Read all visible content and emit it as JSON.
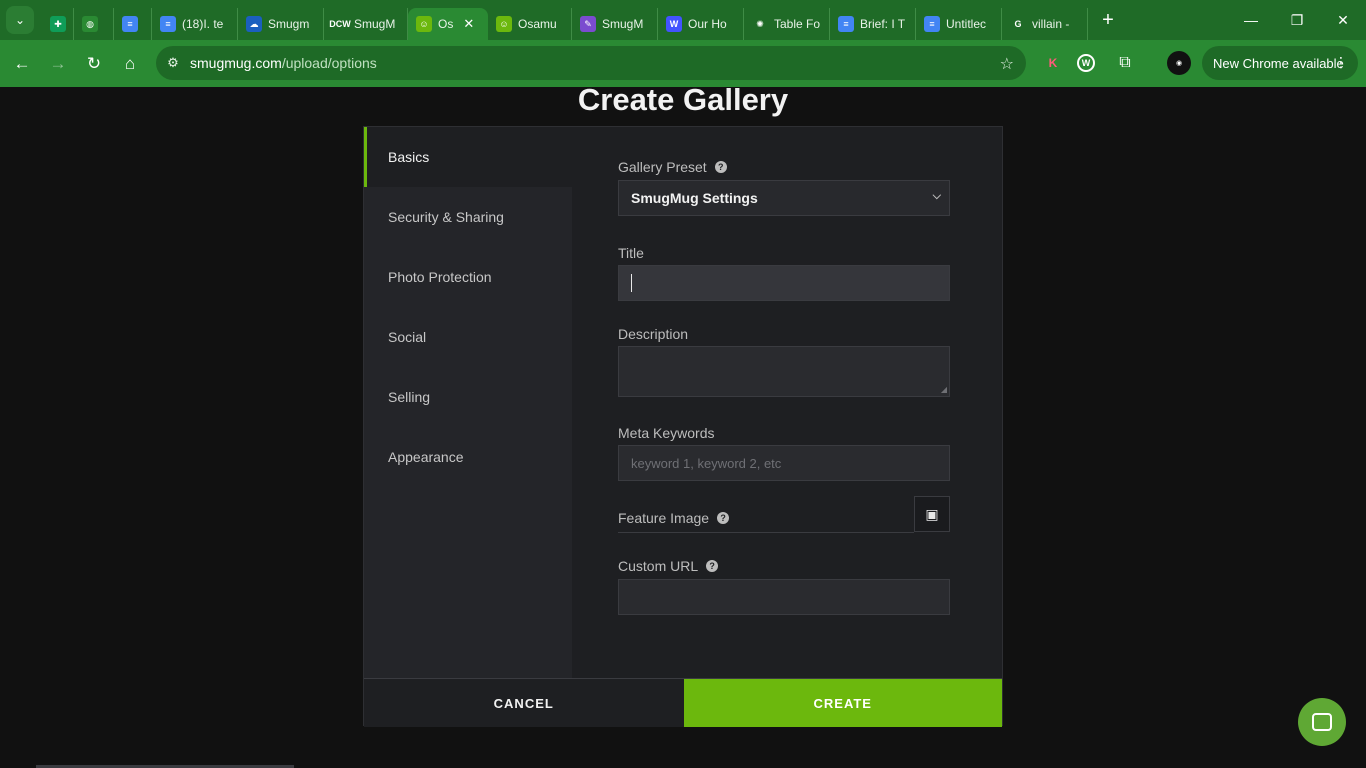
{
  "browser": {
    "tabs": [
      {
        "label": "",
        "favicon": "sheets-icon",
        "color": "#0f9d58",
        "glyph": "✚"
      },
      {
        "label": "",
        "favicon": "globe-icon",
        "color": "#2a8a33",
        "glyph": "◍"
      },
      {
        "label": "",
        "favicon": "docs-icon",
        "color": "#4285f4",
        "glyph": "≡"
      },
      {
        "label": "(18)I. te",
        "favicon": "docs-icon",
        "color": "#4285f4",
        "glyph": "≡"
      },
      {
        "label": "Smugm",
        "favicon": "cloud-icon",
        "color": "#1b5fbf",
        "glyph": "☁"
      },
      {
        "label": "SmugM",
        "favicon": "dcw-icon",
        "color": "#ffffff",
        "glyph": "DCW"
      },
      {
        "label": "Os",
        "favicon": "smugmug-icon",
        "color": "#6cb80d",
        "glyph": "☺",
        "active": true
      },
      {
        "label": "Osamu",
        "favicon": "smugmug-icon",
        "color": "#6cb80d",
        "glyph": "☺"
      },
      {
        "label": "SmugM",
        "favicon": "feather-icon",
        "color": "#7b4ccf",
        "glyph": "✎"
      },
      {
        "label": "Our Ho",
        "favicon": "webflow-icon",
        "color": "#4353ff",
        "glyph": "W"
      },
      {
        "label": "Table Fo",
        "favicon": "openai-icon",
        "color": "#ffffff",
        "glyph": "✺"
      },
      {
        "label": "Brief: I T",
        "favicon": "docs-icon",
        "color": "#4285f4",
        "glyph": "≡"
      },
      {
        "label": "Untitlec",
        "favicon": "docs-icon",
        "color": "#4285f4",
        "glyph": "≡"
      },
      {
        "label": "villain -",
        "favicon": "google-icon",
        "color": "#ffffff",
        "glyph": "G"
      }
    ],
    "url_host": "smugmug.com",
    "url_path": "/upload/options",
    "update_label": "New Chrome available"
  },
  "page": {
    "title": "Create Gallery",
    "sidebar": [
      {
        "label": "Basics",
        "active": true
      },
      {
        "label": "Security & Sharing"
      },
      {
        "label": "Photo Protection"
      },
      {
        "label": "Social"
      },
      {
        "label": "Selling"
      },
      {
        "label": "Appearance"
      }
    ],
    "form": {
      "preset_label": "Gallery Preset",
      "preset_value": "SmugMug Settings",
      "title_label": "Title",
      "title_value": "",
      "description_label": "Description",
      "keywords_label": "Meta Keywords",
      "keywords_placeholder": "keyword 1, keyword 2, etc",
      "feature_image_label": "Feature Image",
      "custom_url_label": "Custom URL",
      "custom_url_value": ""
    },
    "cancel_label": "CANCEL",
    "create_label": "CREATE"
  },
  "colors": {
    "accent": "#6cb80d",
    "chrome": "#2a8a33",
    "background": "#111111"
  }
}
